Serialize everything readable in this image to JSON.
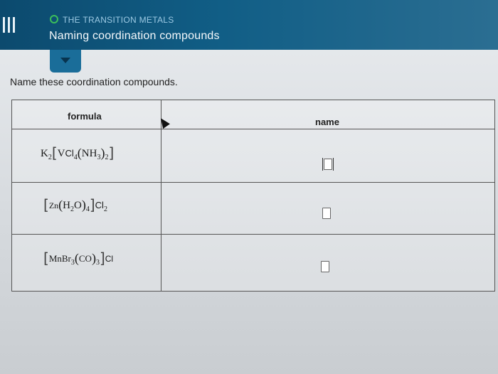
{
  "header": {
    "topic": "THE TRANSITION METALS",
    "title": "Naming coordination compounds"
  },
  "instructions": "Name these coordination compounds.",
  "table": {
    "columns": [
      "formula",
      "name"
    ],
    "rows": [
      {
        "metal": "V",
        "answer": ""
      },
      {
        "metal": "Zn",
        "answer": ""
      },
      {
        "metal": "Mn",
        "answer": ""
      }
    ]
  },
  "colors": {
    "header_bg": "#0c4a6e",
    "topic_ring": "#3cbf5a"
  },
  "icons": [
    "menu-icon",
    "chevron-down-icon",
    "mouse-pointer-icon"
  ]
}
